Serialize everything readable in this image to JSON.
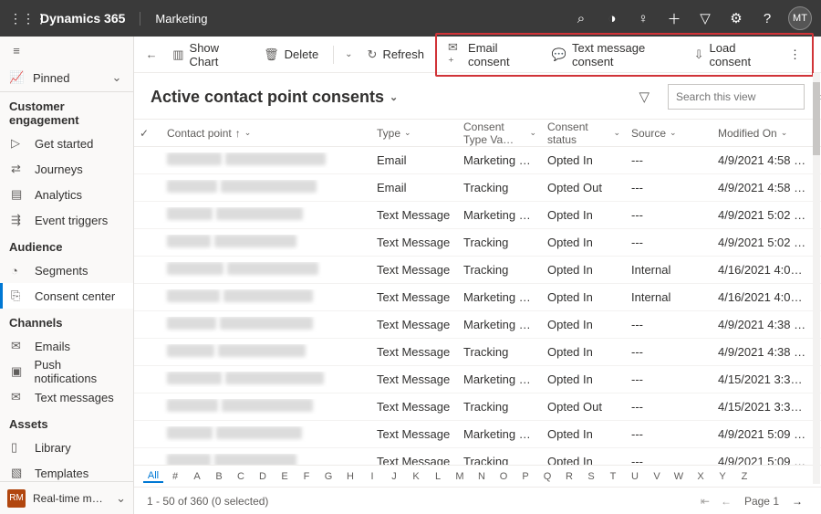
{
  "topbar": {
    "brand": "Dynamics 365",
    "module": "Marketing",
    "avatar": "MT"
  },
  "sidebar": {
    "pinned": "Pinned",
    "groups": [
      {
        "title": "Customer engagement",
        "items": [
          {
            "icon": "▷",
            "label": "Get started"
          },
          {
            "icon": "⇄",
            "label": "Journeys"
          },
          {
            "icon": "▤",
            "label": "Analytics"
          },
          {
            "icon": "⇶",
            "label": "Event triggers"
          }
        ]
      },
      {
        "title": "Audience",
        "items": [
          {
            "icon": "◔",
            "label": "Segments"
          },
          {
            "icon": "⎘",
            "label": "Consent center",
            "active": true
          }
        ]
      },
      {
        "title": "Channels",
        "items": [
          {
            "icon": "✉",
            "label": "Emails"
          },
          {
            "icon": "▣",
            "label": "Push notifications"
          },
          {
            "icon": "✉",
            "label": "Text messages"
          }
        ]
      },
      {
        "title": "Assets",
        "items": [
          {
            "icon": "▯",
            "label": "Library"
          },
          {
            "icon": "▧",
            "label": "Templates"
          }
        ]
      }
    ],
    "switcher": {
      "badge": "RM",
      "label": "Real-time marketi…"
    }
  },
  "cmdbar": {
    "show_chart": "Show Chart",
    "delete": "Delete",
    "refresh": "Refresh",
    "email_consent": "Email consent",
    "text_consent": "Text message consent",
    "load_consent": "Load consent"
  },
  "view": {
    "title": "Active contact point consents",
    "search_ph": "Search this view"
  },
  "grid": {
    "headers": {
      "contact": "Contact point",
      "type": "Type",
      "ctv": "Consent Type Va…",
      "status": "Consent status",
      "source": "Source",
      "modified": "Modified On"
    },
    "rows": [
      {
        "type": "Email",
        "ctv": "Marketing Co…",
        "status": "Opted In",
        "source": "---",
        "mod": "4/9/2021 4:58 …",
        "w1": 60,
        "w2": 110
      },
      {
        "type": "Email",
        "ctv": "Tracking",
        "status": "Opted Out",
        "source": "---",
        "mod": "4/9/2021 4:58 …",
        "w1": 55,
        "w2": 105
      },
      {
        "type": "Text Message",
        "ctv": "Marketing Co…",
        "status": "Opted In",
        "source": "---",
        "mod": "4/9/2021 5:02 …",
        "w1": 50,
        "w2": 95
      },
      {
        "type": "Text Message",
        "ctv": "Tracking",
        "status": "Opted In",
        "source": "---",
        "mod": "4/9/2021 5:02 …",
        "w1": 48,
        "w2": 90
      },
      {
        "type": "Text Message",
        "ctv": "Tracking",
        "status": "Opted In",
        "source": "Internal",
        "mod": "4/16/2021 4:0…",
        "w1": 62,
        "w2": 100
      },
      {
        "type": "Text Message",
        "ctv": "Marketing Co…",
        "status": "Opted In",
        "source": "Internal",
        "mod": "4/16/2021 4:0…",
        "w1": 58,
        "w2": 98
      },
      {
        "type": "Text Message",
        "ctv": "Marketing Co…",
        "status": "Opted In",
        "source": "---",
        "mod": "4/9/2021 4:38 …",
        "w1": 54,
        "w2": 102
      },
      {
        "type": "Text Message",
        "ctv": "Tracking",
        "status": "Opted In",
        "source": "---",
        "mod": "4/9/2021 4:38 …",
        "w1": 52,
        "w2": 96
      },
      {
        "type": "Text Message",
        "ctv": "Marketing Co…",
        "status": "Opted In",
        "source": "---",
        "mod": "4/15/2021 3:3…",
        "w1": 60,
        "w2": 108
      },
      {
        "type": "Text Message",
        "ctv": "Tracking",
        "status": "Opted Out",
        "source": "---",
        "mod": "4/15/2021 3:3…",
        "w1": 56,
        "w2": 100
      },
      {
        "type": "Text Message",
        "ctv": "Marketing Co…",
        "status": "Opted In",
        "source": "---",
        "mod": "4/9/2021 5:09 …",
        "w1": 50,
        "w2": 94
      },
      {
        "type": "Text Message",
        "ctv": "Tracking",
        "status": "Opted In",
        "source": "---",
        "mod": "4/9/2021 5:09 …",
        "w1": 48,
        "w2": 90
      }
    ]
  },
  "alphabet": [
    "All",
    "#",
    "A",
    "B",
    "C",
    "D",
    "E",
    "F",
    "G",
    "H",
    "I",
    "J",
    "K",
    "L",
    "M",
    "N",
    "O",
    "P",
    "Q",
    "R",
    "S",
    "T",
    "U",
    "V",
    "W",
    "X",
    "Y",
    "Z"
  ],
  "footer": {
    "status": "1 - 50 of 360 (0 selected)",
    "page": "Page 1"
  }
}
